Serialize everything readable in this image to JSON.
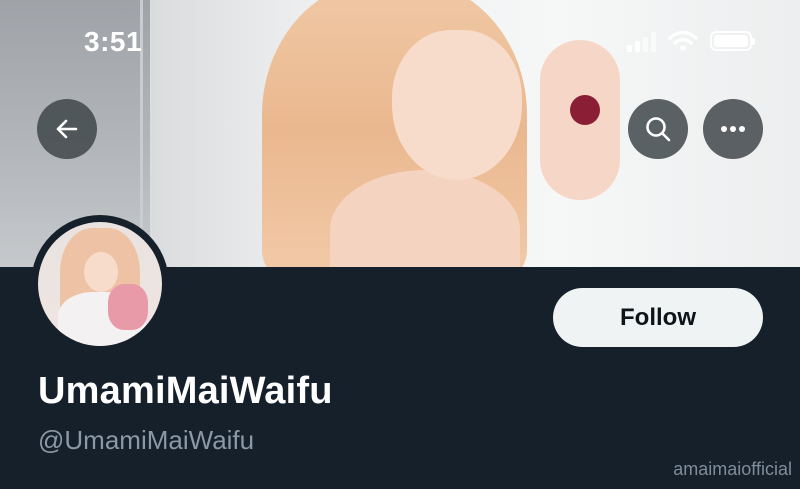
{
  "status_bar": {
    "time": "3:51",
    "icons": [
      "signal-icon",
      "wifi-icon",
      "battery-icon"
    ]
  },
  "header": {
    "back_icon": "arrow-left-icon",
    "search_icon": "search-icon",
    "more_icon": "more-horizontal-icon"
  },
  "profile": {
    "display_name": "UmamiMaiWaifu",
    "handle": "@UmamiMaiWaifu",
    "follow_label": "Follow"
  },
  "watermark": "amaimaiofficial",
  "colors": {
    "background": "#15202b",
    "follow_button_bg": "#eff3f4",
    "handle_text": "#8b98a5"
  }
}
